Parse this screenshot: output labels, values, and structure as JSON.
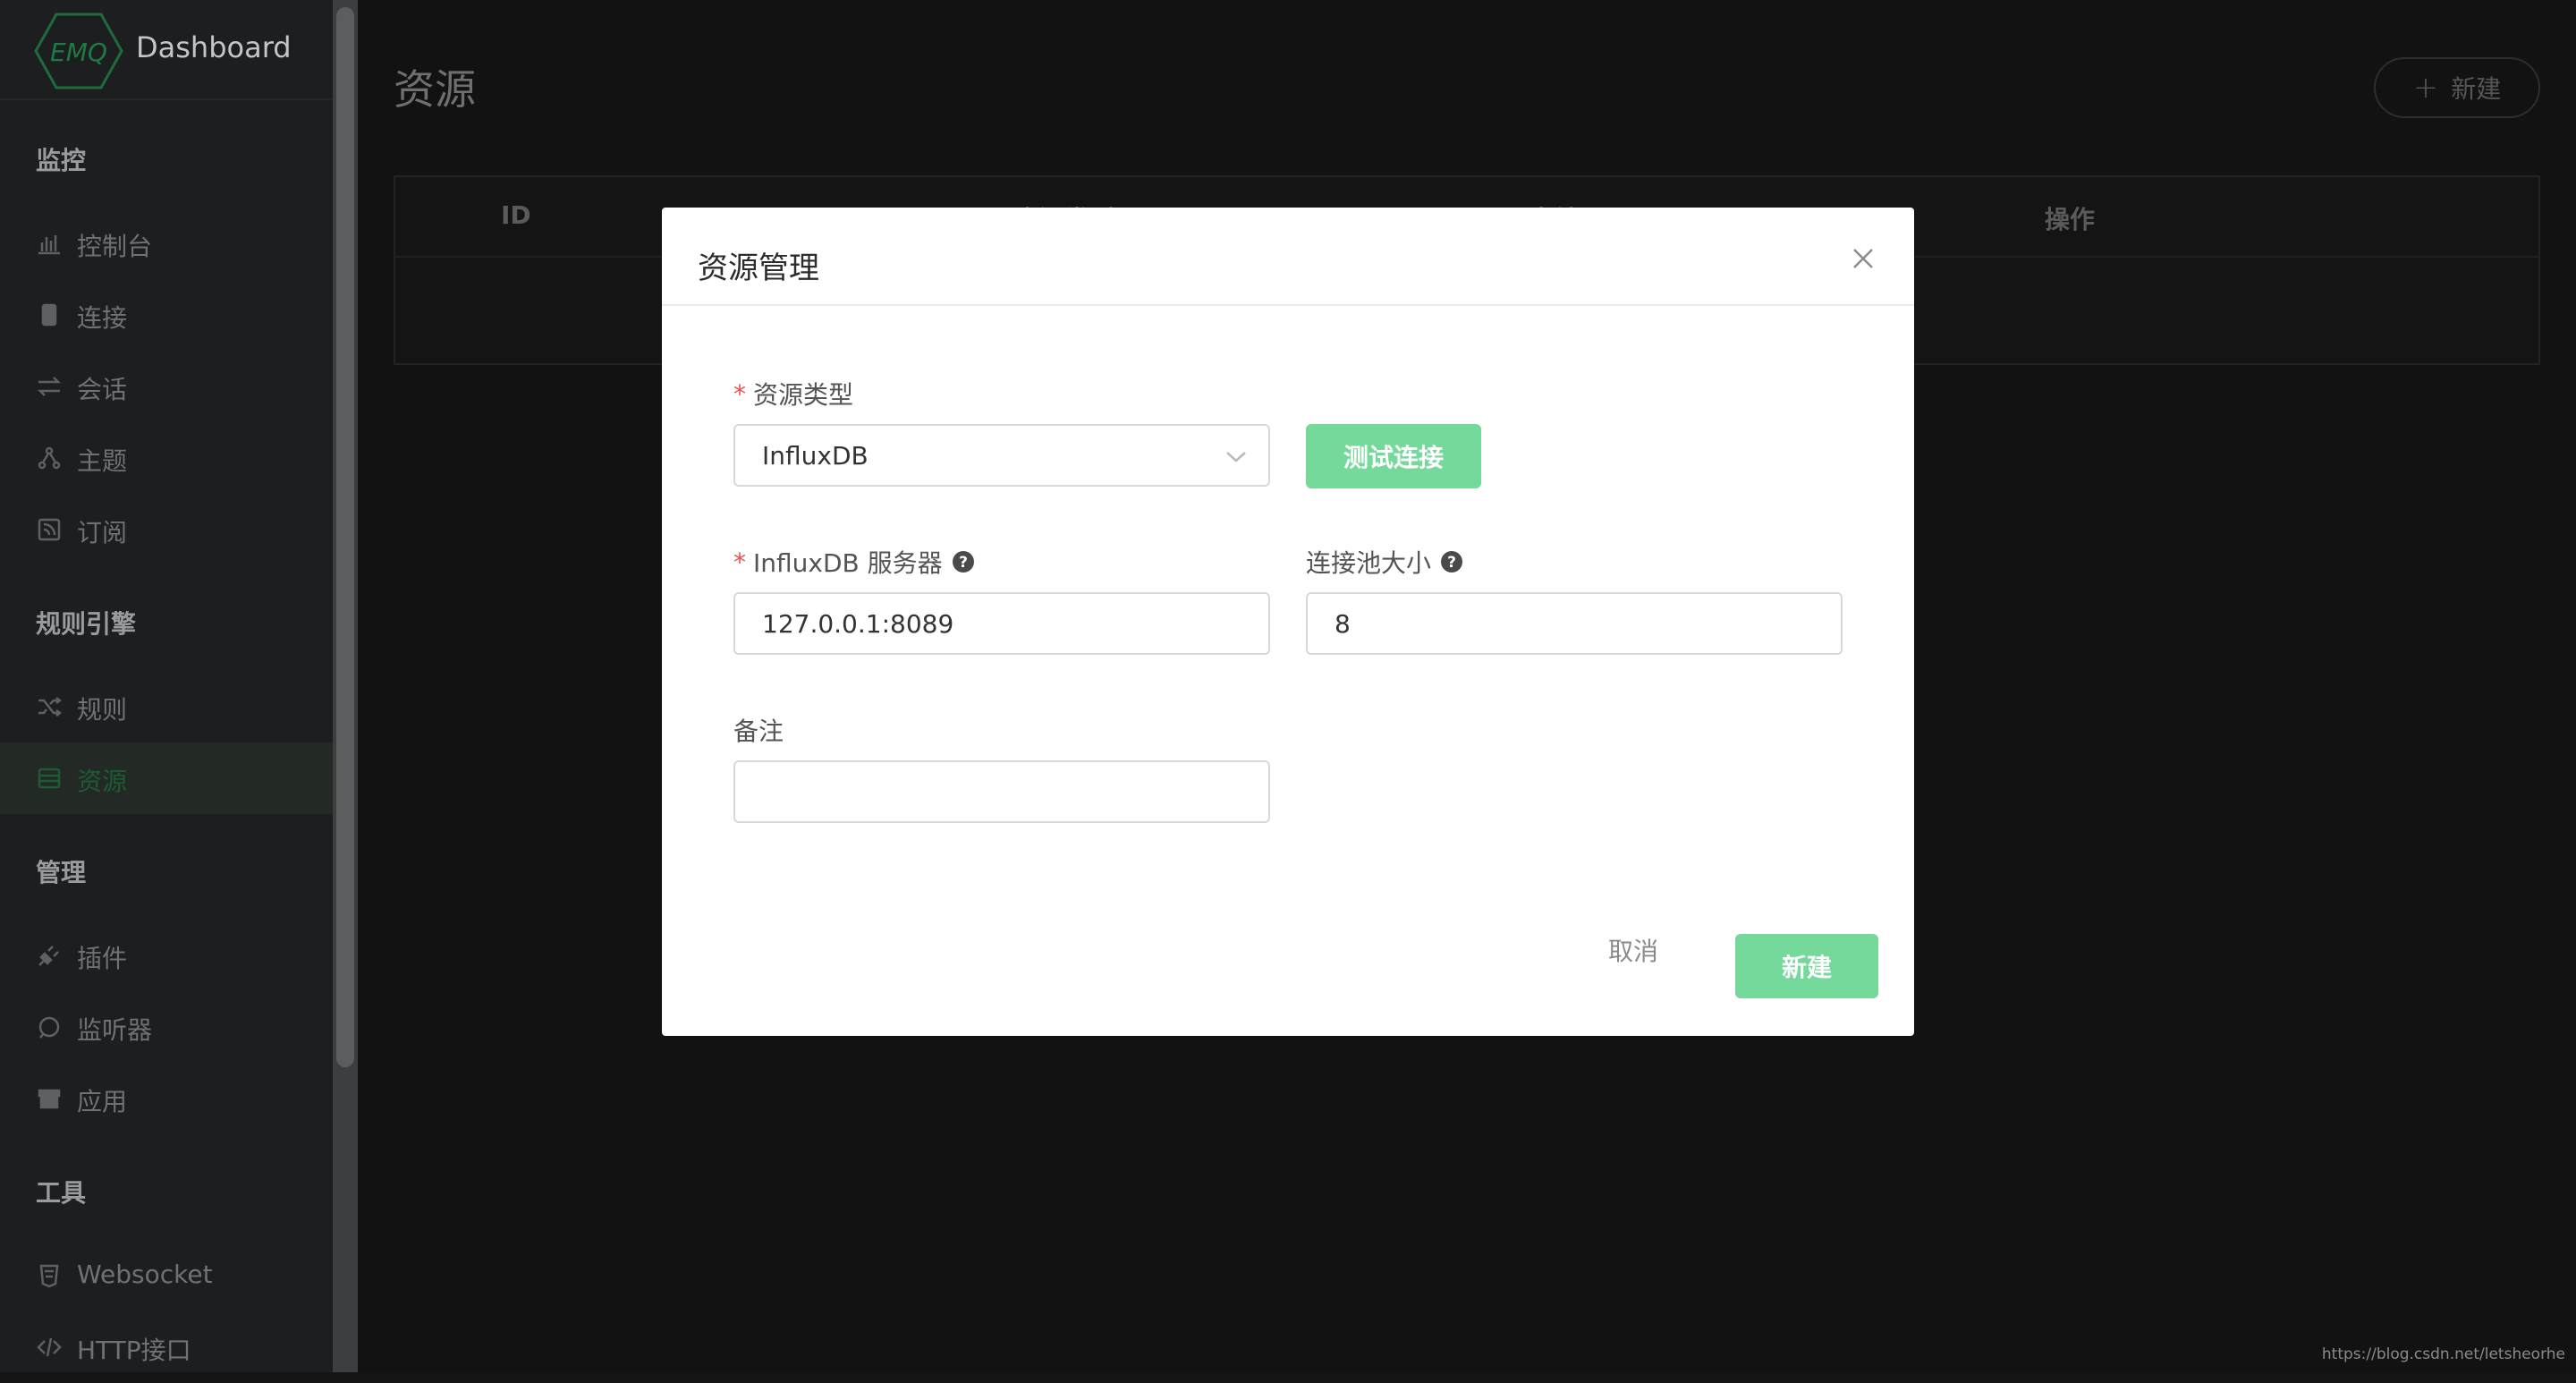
{
  "sidebar": {
    "logo_text": "EMQ",
    "app_title": "Dashboard",
    "groups": [
      {
        "label": "监控"
      },
      {
        "label": "规则引擎"
      },
      {
        "label": "管理"
      },
      {
        "label": "工具"
      }
    ],
    "items": [
      {
        "label": "控制台",
        "icon": "chart-icon"
      },
      {
        "label": "连接",
        "icon": "connection-icon"
      },
      {
        "label": "会话",
        "icon": "session-icon"
      },
      {
        "label": "主题",
        "icon": "topic-icon"
      },
      {
        "label": "订阅",
        "icon": "subscription-icon"
      },
      {
        "label": "规则",
        "icon": "shuffle-icon"
      },
      {
        "label": "资源",
        "icon": "database-icon",
        "active": true
      },
      {
        "label": "插件",
        "icon": "plug-icon"
      },
      {
        "label": "监听器",
        "icon": "listener-icon"
      },
      {
        "label": "应用",
        "icon": "archive-icon"
      },
      {
        "label": "Websocket",
        "icon": "html5-icon"
      },
      {
        "label": "HTTP接口",
        "icon": "code-icon"
      }
    ]
  },
  "main": {
    "title": "资源",
    "new_button_label": "新建",
    "table": {
      "columns": [
        "ID",
        "资源类型",
        "备注",
        "操作"
      ]
    },
    "footer_url": "https://blog.csdn.net/letsheorhe"
  },
  "modal": {
    "title": "资源管理",
    "resource_type_label": "资源类型",
    "resource_type_value": "InfluxDB",
    "test_button_label": "测试连接",
    "server_label": "InfluxDB 服务器",
    "server_value": "127.0.0.1:8089",
    "pool_label": "连接池大小",
    "pool_value": "8",
    "remark_label": "备注",
    "remark_value": "",
    "cancel_label": "取消",
    "create_label": "新建"
  },
  "colors": {
    "accent": "#74d99a",
    "required": "#f04d4d",
    "active_nav": "#1d5a35"
  }
}
